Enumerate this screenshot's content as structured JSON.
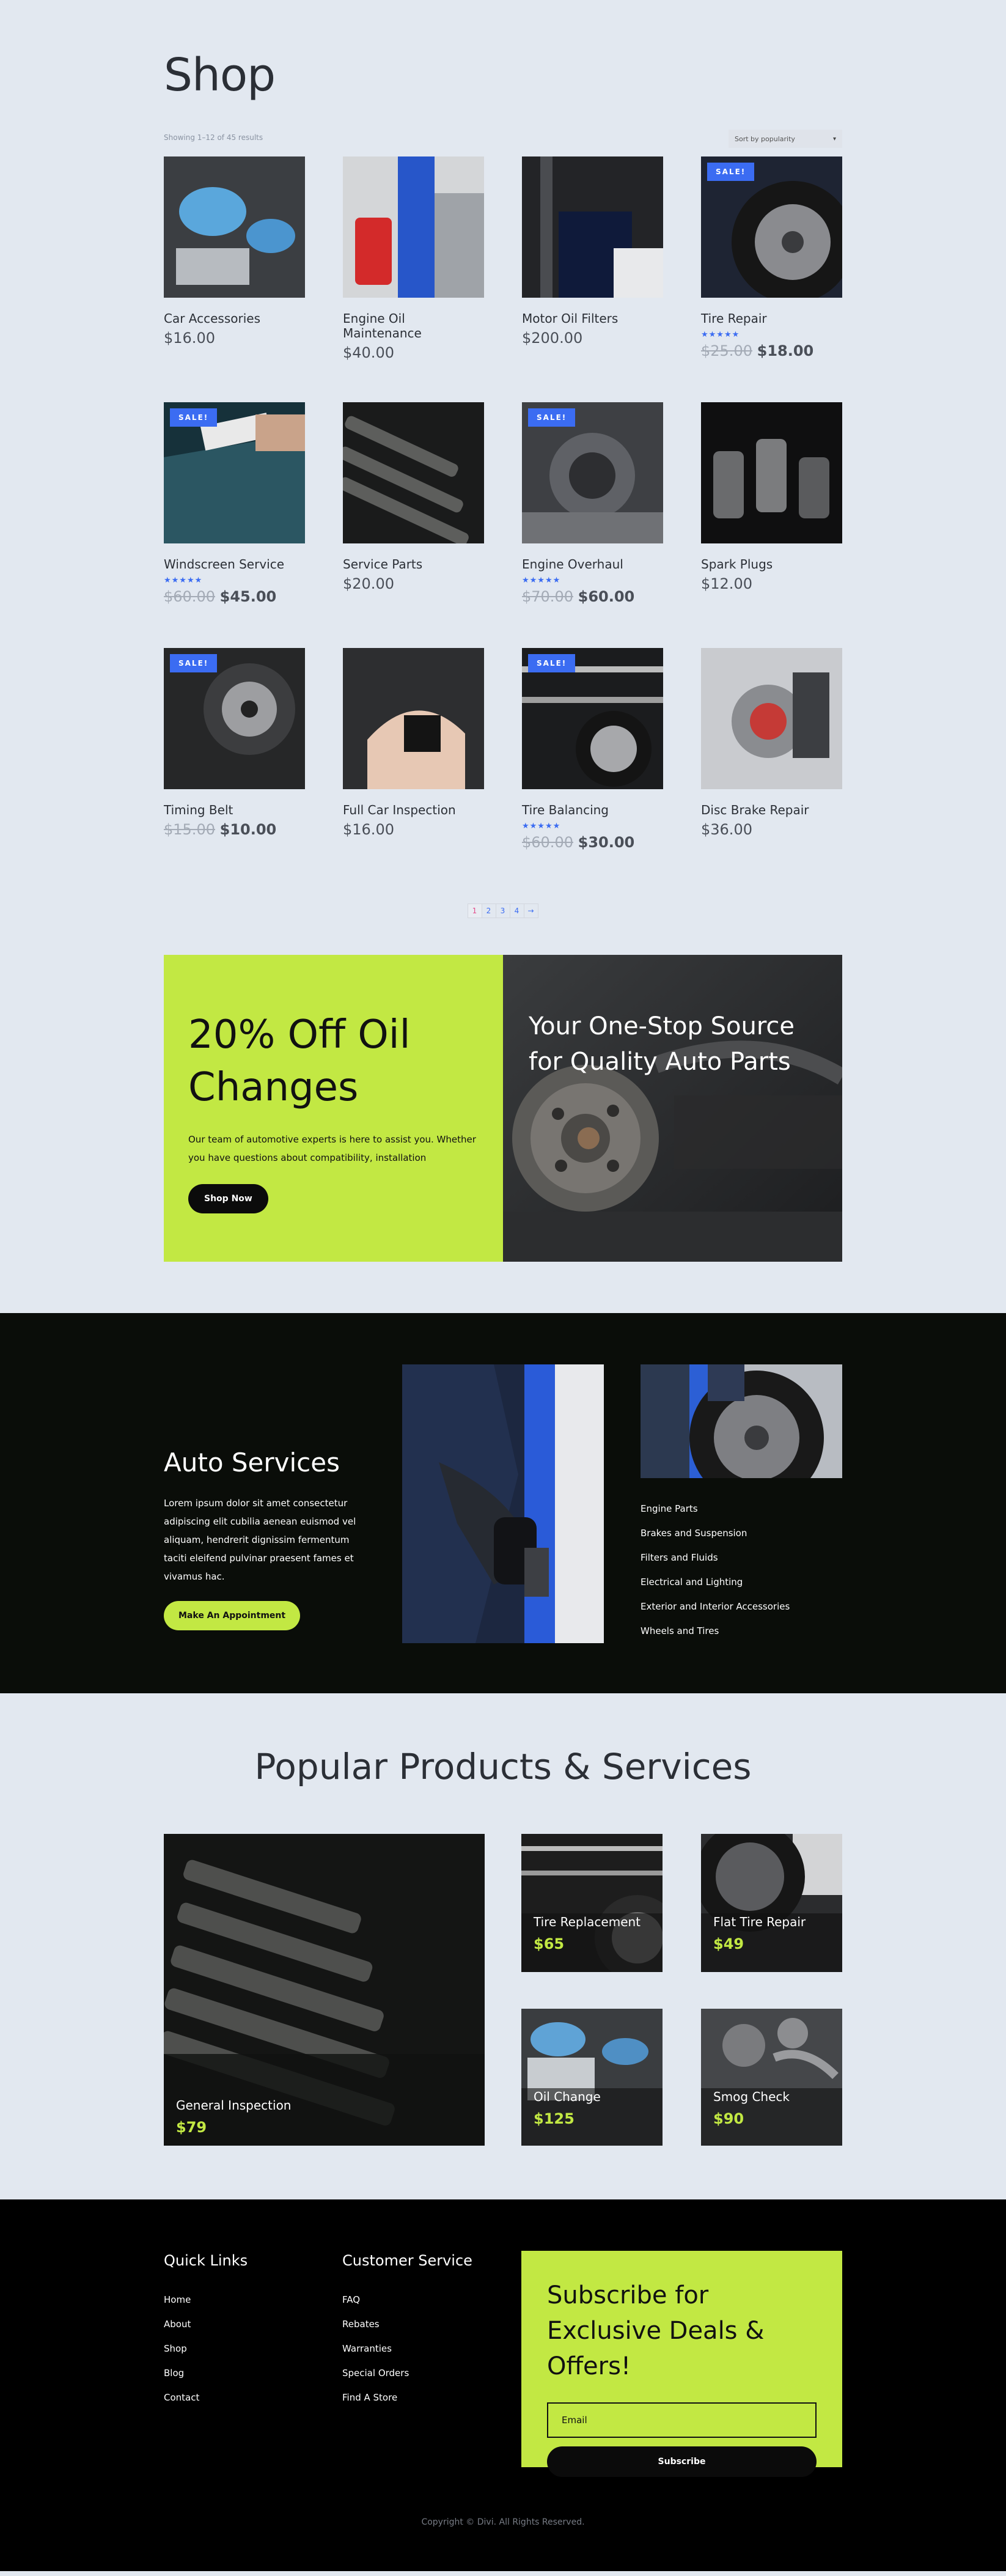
{
  "shop": {
    "title": "Shop",
    "result_count": "Showing 1–12 of 45 results",
    "sort_selected": "Sort by popularity"
  },
  "products": [
    {
      "name": "Car Accessories",
      "price": "$16.00",
      "sale": false,
      "rating": 0
    },
    {
      "name": "Engine Oil Maintenance",
      "price": "$40.00",
      "sale": false,
      "rating": 0
    },
    {
      "name": "Motor Oil Filters",
      "price": "$200.00",
      "sale": false,
      "rating": 0
    },
    {
      "name": "Tire Repair",
      "old_price": "$25.00",
      "price": "$18.00",
      "sale": true,
      "rating": 5
    },
    {
      "name": "Windscreen Service",
      "old_price": "$60.00",
      "price": "$45.00",
      "sale": true,
      "rating": 5
    },
    {
      "name": "Service Parts",
      "price": "$20.00",
      "sale": false,
      "rating": 0
    },
    {
      "name": "Engine Overhaul",
      "old_price": "$70.00",
      "price": "$60.00",
      "sale": true,
      "rating": 5
    },
    {
      "name": "Spark Plugs",
      "price": "$12.00",
      "sale": false,
      "rating": 0
    },
    {
      "name": "Timing Belt",
      "old_price": "$15.00",
      "price": "$10.00",
      "sale": true,
      "rating": 0
    },
    {
      "name": "Full Car Inspection",
      "price": "$16.00",
      "sale": false,
      "rating": 0
    },
    {
      "name": "Tire Balancing",
      "old_price": "$60.00",
      "price": "$30.00",
      "sale": true,
      "rating": 5
    },
    {
      "name": "Disc Brake Repair",
      "price": "$36.00",
      "sale": false,
      "rating": 0
    }
  ],
  "sale_badge": "SALE!",
  "stars_text": "★★★★★",
  "pagination": [
    "1",
    "2",
    "3",
    "4",
    "→"
  ],
  "promo": {
    "title": "20% Off Oil Changes",
    "description": "Our team of automotive experts is here to assist you. Whether you have questions about compatibility, installation",
    "button": "Shop Now",
    "image_caption": "Your One-Stop Source for Quality Auto Parts"
  },
  "services": {
    "title": "Auto Services",
    "text": "Lorem ipsum dolor sit amet consectetur adipiscing elit cubilia aenean euismod vel aliquam, hendrerit dignissim fermentum taciti eleifend pulvinar praesent fames et vivamus hac.",
    "button": "Make An Appointment",
    "list": [
      "Engine Parts",
      "Brakes and Suspension",
      "Filters and Fluids",
      "Electrical and Lighting",
      "Exterior and Interior Accessories",
      "Wheels and Tires"
    ]
  },
  "popular": {
    "title": "Popular Products & Services",
    "items": [
      {
        "name": "General Inspection",
        "price": "$79"
      },
      {
        "name": "Tire Replacement",
        "price": "$65"
      },
      {
        "name": "Flat Tire Repair",
        "price": "$49"
      },
      {
        "name": "Oil Change",
        "price": "$125"
      },
      {
        "name": "Smog Check",
        "price": "$90"
      }
    ]
  },
  "footer": {
    "quick_links_title": "Quick Links",
    "quick_links": [
      "Home",
      "About",
      "Shop",
      "Blog",
      "Contact"
    ],
    "customer_service_title": "Customer Service",
    "customer_service": [
      "FAQ",
      "Rebates",
      "Warranties",
      "Special Orders",
      "Find A Store"
    ],
    "subscribe_title": "Subscribe for Exclusive Deals & Offers!",
    "email_placeholder": "Email",
    "subscribe_button": "Subscribe",
    "copyright": "Copyright © Divi. All Rights Reserved."
  },
  "colors": {
    "background": "#e2e8f0",
    "accent_lime": "#c2e843",
    "sale_blue": "#3b6cf2",
    "dark": "#0a0d09"
  }
}
